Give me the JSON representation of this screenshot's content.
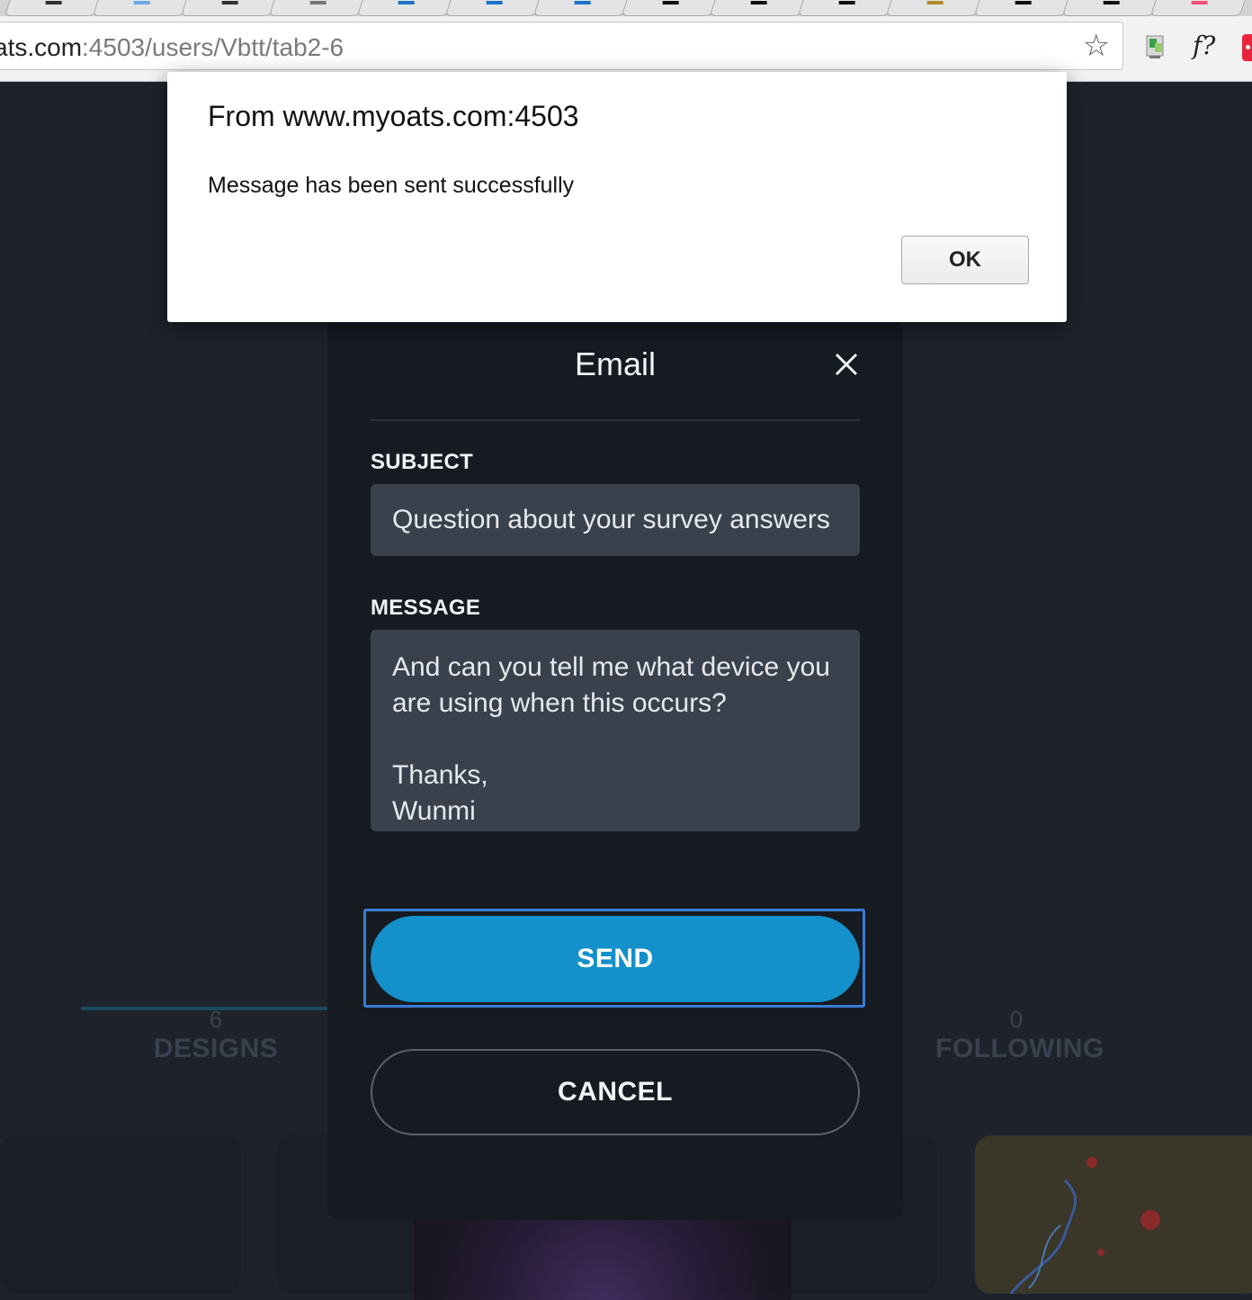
{
  "browser": {
    "url_host": "ats.com",
    "url_path": ":4503/users/Vbtt/tab2-6",
    "bookmark_icon": "star-icon",
    "extensions": [
      "extension-icon",
      "fontface-ninja-icon",
      "red-extension-icon"
    ],
    "ext2_label": "f?"
  },
  "alert": {
    "title": "From www.myoats.com:4503",
    "message": "Message has been sent successfully",
    "ok_label": "OK"
  },
  "email_modal": {
    "title": "Email",
    "close_icon": "close-icon",
    "subject_label": "SUBJECT",
    "subject_value": "Question about your survey answers",
    "message_label": "MESSAGE",
    "message_value": "And can you tell me what device you\nare using when this occurs?\n\nThanks,\nWunmi",
    "send_label": "SEND",
    "cancel_label": "CANCEL",
    "accent_color": "#1490ca"
  },
  "profile_stats": {
    "designs_count": "6",
    "designs_label": "DESIGNS",
    "following_count": "0",
    "following_label": "FOLLOWING"
  }
}
